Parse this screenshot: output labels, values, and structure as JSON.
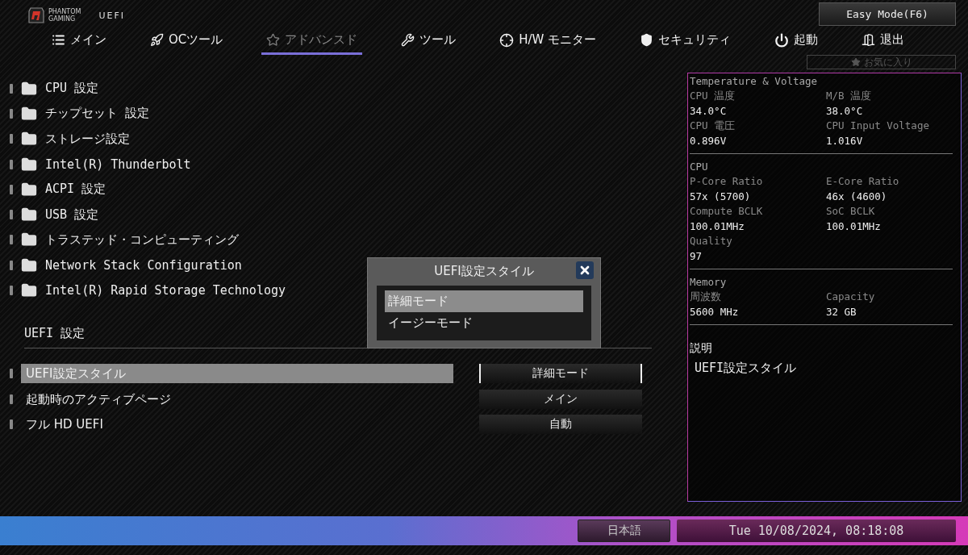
{
  "header": {
    "brand_lines": [
      "PHANTOM",
      "GAMING"
    ],
    "product": "UEFI",
    "easy_mode_button": "Easy Mode(F6)",
    "favorites_button": "お気に入り"
  },
  "tabs": [
    {
      "label": "メイン",
      "selected": false
    },
    {
      "label": "OCツール",
      "selected": false
    },
    {
      "label": "アドバンスド",
      "selected": true
    },
    {
      "label": "ツール",
      "selected": false
    },
    {
      "label": "H/W モニター",
      "selected": false
    },
    {
      "label": "セキュリティ",
      "selected": false
    },
    {
      "label": "起動",
      "selected": false
    },
    {
      "label": "退出",
      "selected": false
    }
  ],
  "menu_items": [
    {
      "label": "CPU 設定"
    },
    {
      "label": "チップセット 設定"
    },
    {
      "label": "ストレージ設定"
    },
    {
      "label": "Intel(R) Thunderbolt"
    },
    {
      "label": "ACPI 設定"
    },
    {
      "label": "USB 設定"
    },
    {
      "label": "トラステッド・コンピューティング"
    },
    {
      "label": "Network Stack Configuration"
    },
    {
      "label": "Intel(R) Rapid Storage Technology"
    }
  ],
  "section_title": "UEFI 設定",
  "settings": [
    {
      "label": "UEFI設定スタイル",
      "value": "詳細モード",
      "selected": true
    },
    {
      "label": "起動時のアクティブページ",
      "value": "メイン",
      "selected": false
    },
    {
      "label": "フル HD UEFI",
      "value": "自動",
      "selected": false
    }
  ],
  "info_panel": {
    "sections": [
      {
        "title": "Temperature & Voltage",
        "fields": [
          {
            "label": "CPU 温度",
            "value": "34.0°C"
          },
          {
            "label": "M/B 温度",
            "value": "38.0°C"
          },
          {
            "label": "CPU 電圧",
            "value": "0.896V"
          },
          {
            "label": "CPU Input Voltage",
            "value": "1.016V"
          }
        ]
      },
      {
        "title": "CPU",
        "fields": [
          {
            "label": "P-Core Ratio",
            "value": "57x (5700)"
          },
          {
            "label": "E-Core Ratio",
            "value": "46x (4600)"
          },
          {
            "label": "Compute BCLK",
            "value": "100.01MHz"
          },
          {
            "label": "SoC BCLK",
            "value": "100.01MHz"
          },
          {
            "label": "Quality",
            "value": "97"
          }
        ]
      },
      {
        "title": "Memory",
        "fields": [
          {
            "label": "周波数",
            "value": "5600 MHz"
          },
          {
            "label": "Capacity",
            "value": "32 GB"
          }
        ]
      }
    ],
    "description_title": "説明",
    "description": "UEFI設定スタイル"
  },
  "popup": {
    "title": "UEFI設定スタイル",
    "options": [
      {
        "label": "詳細モード",
        "selected": true
      },
      {
        "label": "イージーモード",
        "selected": false
      }
    ]
  },
  "status_bar": {
    "language": "日本語",
    "datetime": "Tue 10/08/2024, 08:18:08"
  }
}
